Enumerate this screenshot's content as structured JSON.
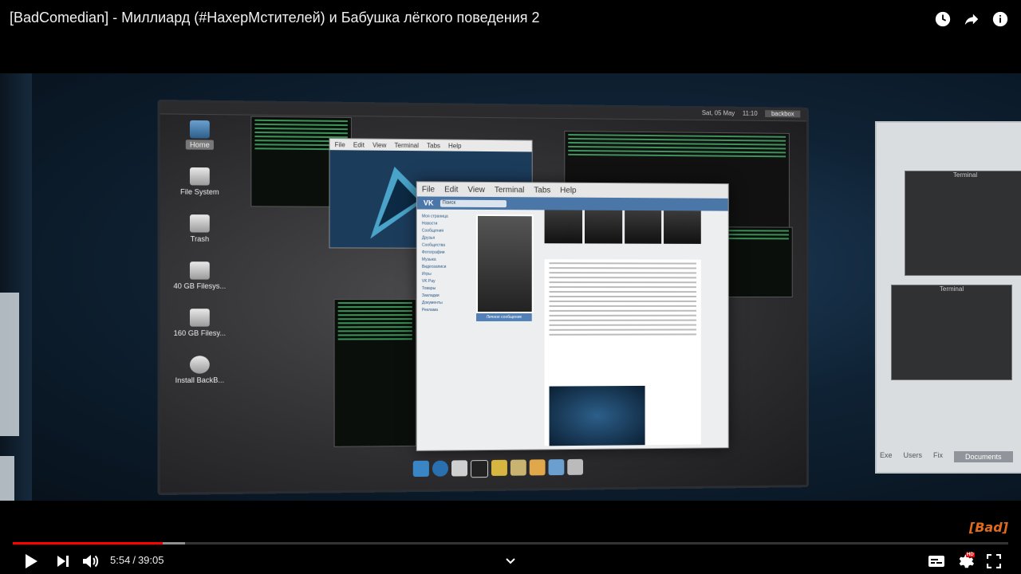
{
  "video": {
    "title": "[BadComedian] - Миллиард (#НахерМстителей) и Бабушка лёгкого поведения 2",
    "top_icons": [
      "clock-icon",
      "share-icon",
      "info-icon"
    ]
  },
  "scene": {
    "desktop_icons": [
      {
        "name": "home",
        "label": "Home"
      },
      {
        "name": "file-system",
        "label": "File System"
      },
      {
        "name": "trash",
        "label": "Trash"
      },
      {
        "name": "40gb",
        "label": "40 GB Filesys..."
      },
      {
        "name": "160gb",
        "label": "160 GB Filesy..."
      },
      {
        "name": "install",
        "label": "Install BackB..."
      }
    ],
    "panel": {
      "date": "Sat, 05 May",
      "time": "11:10",
      "host": "backbox"
    },
    "window_menu": [
      "File",
      "Edit",
      "View",
      "Terminal",
      "Tabs",
      "Help"
    ],
    "vk": {
      "logo": "VK",
      "search_placeholder": "Поиск",
      "sidebar": [
        "Моя страница",
        "Новости",
        "Сообщения",
        "Друзья",
        "Сообщества",
        "Фотографии",
        "Музыка",
        "Видеозаписи",
        "Игры",
        "VK Pay",
        "Товары",
        "Закладки",
        "Документы",
        "Реклама"
      ],
      "message_button": "Личное сообщение"
    },
    "right_panel": {
      "term_title": "Terminal",
      "term_title2": "Terminal",
      "tabs": [
        "Exe",
        "Users",
        "Fix",
        "Documents"
      ],
      "active_tab": "Documents"
    },
    "brand": "[Bad]"
  },
  "player": {
    "current_time": "5:54",
    "separator": "/",
    "duration": "39:05",
    "played_fraction": 0.151,
    "buffered_fraction": 0.173,
    "hd_label": "HD",
    "colors": {
      "played": "#ff0000",
      "brand": "#e06b1c"
    }
  }
}
